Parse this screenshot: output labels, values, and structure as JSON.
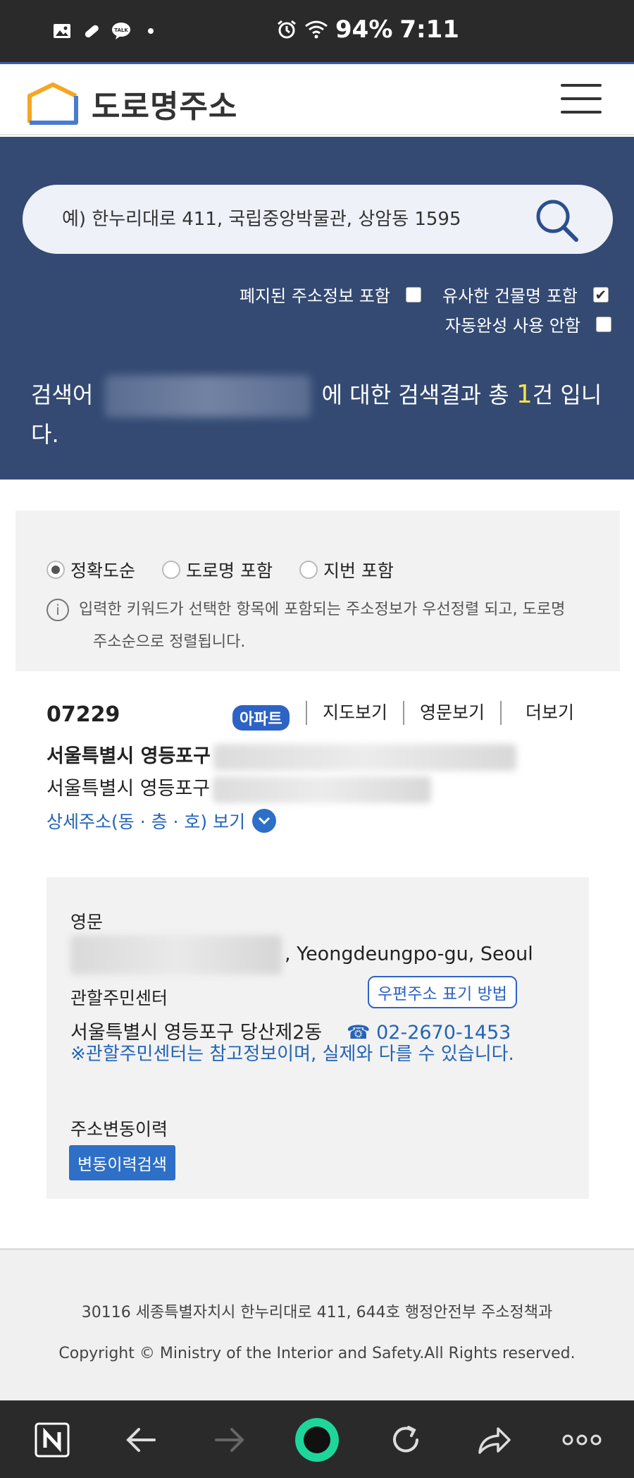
{
  "status_bar": {
    "battery": "94%",
    "time": "7:11",
    "icons": [
      "image-icon",
      "bandage-icon",
      "talk-icon",
      "dot-icon",
      "alarm-icon",
      "wifi-icon"
    ]
  },
  "header": {
    "logo_text": "도로명주소",
    "menu_icon": "hamburger-icon"
  },
  "search": {
    "placeholder": "예) 한누리대로 411, 국립중앙박물관, 상암동 1595",
    "options": {
      "abolished": {
        "label": "폐지된 주소정보 포함",
        "checked": false
      },
      "similar_building": {
        "label": "유사한 건물명 포함",
        "checked": true
      },
      "no_autocomplete": {
        "label": "자동완성 사용 안함",
        "checked": false
      }
    },
    "result_prefix": "검색어",
    "result_mid": "에 대한 검색결과 총",
    "result_count": "1",
    "result_suffix": "건 입니다."
  },
  "sort": {
    "options": [
      {
        "label": "정확도순",
        "selected": true
      },
      {
        "label": "도로명 포함",
        "selected": false
      },
      {
        "label": "지번 포함",
        "selected": false
      }
    ],
    "info_line1": "입력한 키워드가 선택한 항목에 포함되는 주소정보가 우선정렬 되고, 도로명",
    "info_line2": "주소순으로 정렬됩니다."
  },
  "result": {
    "zip": "07229",
    "badge": "아파트",
    "links": {
      "map": "지도보기",
      "english": "영문보기",
      "more": "더보기"
    },
    "road_addr_prefix": "서울특별시 영등포구",
    "jibun_addr_prefix": "서울특별시 영등포구",
    "detail_link": "상세주소(동 · 층 · 호) 보기"
  },
  "info_box": {
    "english_label": "영문",
    "english_suffix": ", Yeongdeungpo-gu, Seoul",
    "center_label": "관할주민센터",
    "postal_button": "우편주소 표기 방법",
    "center_name": "서울특별시 영등포구 당산제2동",
    "phone": "02-2670-1453",
    "notice": "※관할주민센터는 참고정보이며, 실제와 다를 수 있습니다.",
    "history_label": "주소변동이력",
    "history_button": "변동이력검색"
  },
  "footer": {
    "address": "30116 세종특별자치시 한누리대로 411, 644호 행정안전부 주소정책과",
    "copyright": "Copyright © Ministry of the Interior and Safety.All Rights reserved."
  },
  "colors": {
    "search_band": "#344a73",
    "accent_blue": "#2e63c6",
    "count_yellow": "#f6e14a"
  }
}
